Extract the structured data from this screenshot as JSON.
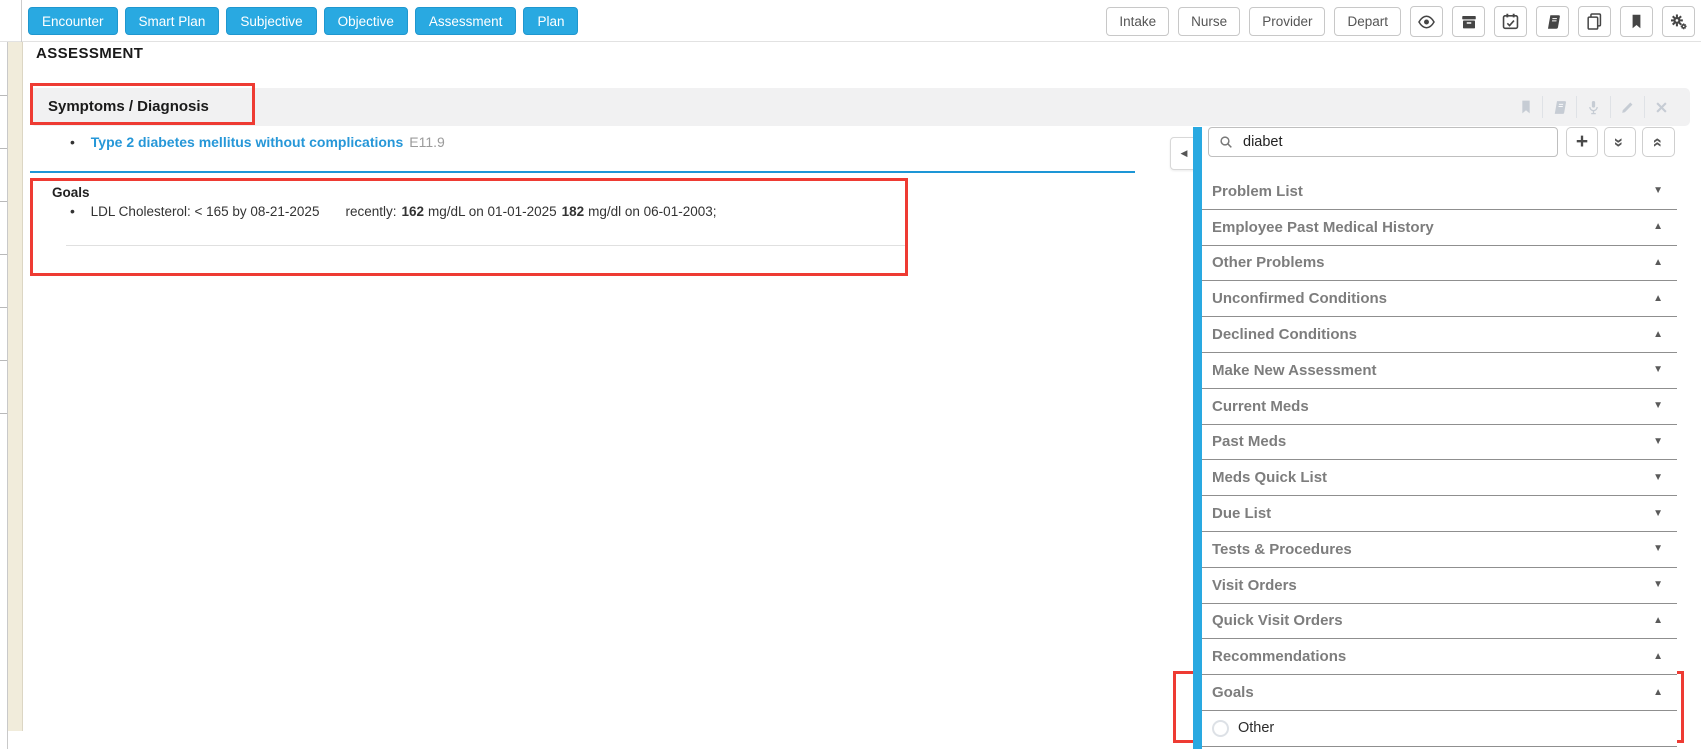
{
  "toolbar": {
    "nav": [
      "Encounter",
      "Smart Plan",
      "Subjective",
      "Objective",
      "Assessment",
      "Plan"
    ],
    "stage": [
      "Intake",
      "Nurse",
      "Provider",
      "Depart"
    ],
    "icons": [
      "eye-icon",
      "archive-box-icon",
      "calendar-check-icon",
      "book-icon",
      "copy-pages-icon",
      "bookmark-icon",
      "settings-gears-icon"
    ]
  },
  "page": {
    "title": "ASSESSMENT"
  },
  "section": {
    "title": "Symptoms / Diagnosis",
    "header_icons": [
      "bookmark-icon",
      "book-icon",
      "microphone-icon",
      "pencil-icon",
      "close-icon"
    ],
    "diagnosis": {
      "name": "Type 2 diabetes mellitus without complications",
      "code": "E11.9"
    }
  },
  "goals": {
    "title": "Goals",
    "goal_text": "LDL Cholesterol: < 165 by 08-21-2025",
    "recently_label": "recently:",
    "readings": [
      {
        "value": "162",
        "rest": "mg/dL on 01-01-2025"
      },
      {
        "value": "182",
        "rest": "mg/dl on 06-01-2003;"
      }
    ]
  },
  "sidebar": {
    "search": {
      "value": "diabet",
      "icon": "search-icon"
    },
    "buttons": [
      "add",
      "expand-all",
      "collapse-all"
    ],
    "collapse_arrow": "left",
    "items": [
      {
        "label": "Problem List",
        "chevron": "down"
      },
      {
        "label": "Employee Past Medical History",
        "chevron": "up"
      },
      {
        "label": "Other Problems",
        "chevron": "up"
      },
      {
        "label": "Unconfirmed Conditions",
        "chevron": "up"
      },
      {
        "label": "Declined Conditions",
        "chevron": "up"
      },
      {
        "label": "Make New Assessment",
        "chevron": "down"
      },
      {
        "label": "Current Meds",
        "chevron": "down"
      },
      {
        "label": "Past Meds",
        "chevron": "down"
      },
      {
        "label": "Meds Quick List",
        "chevron": "down"
      },
      {
        "label": "Due List",
        "chevron": "down"
      },
      {
        "label": "Tests & Procedures",
        "chevron": "down"
      },
      {
        "label": "Visit Orders",
        "chevron": "down"
      },
      {
        "label": "Quick Visit Orders",
        "chevron": "up"
      },
      {
        "label": "Recommendations",
        "chevron": "up"
      },
      {
        "label": "Goals",
        "chevron": "up"
      }
    ],
    "goals_group_item": {
      "label": "Other"
    }
  },
  "colors": {
    "accent_blue": "#29a9e1",
    "link_blue": "#2697d8",
    "annotation_red": "#ee3b33",
    "sidebar_text_gray": "#7d7d7d"
  }
}
